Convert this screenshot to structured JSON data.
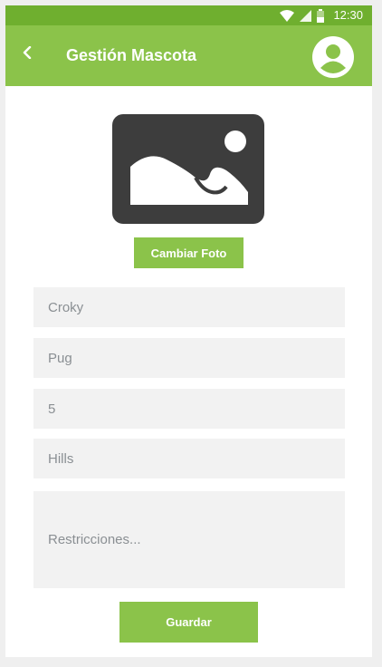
{
  "status_bar": {
    "time": "12:30",
    "icons": [
      "wifi-icon",
      "signal-icon",
      "battery-icon"
    ]
  },
  "app_bar": {
    "title": "Gestión Mascota",
    "back_icon": "chevron-left-icon",
    "profile_icon": "account-circle-icon"
  },
  "photo": {
    "icon": "image-placeholder-icon",
    "change_label": "Cambiar Foto"
  },
  "form": {
    "name": "Croky",
    "breed": "Pug",
    "age": "5",
    "food": "Hills",
    "restrictions_placeholder": "Restricciones..."
  },
  "actions": {
    "save_label": "Guardar"
  },
  "colors": {
    "primary": "#8bc34a",
    "primary_dark": "#6faf2f",
    "field_bg": "#f2f2f2",
    "field_text": "#8a8f93",
    "placeholder_icon": "#3d3d3d"
  }
}
